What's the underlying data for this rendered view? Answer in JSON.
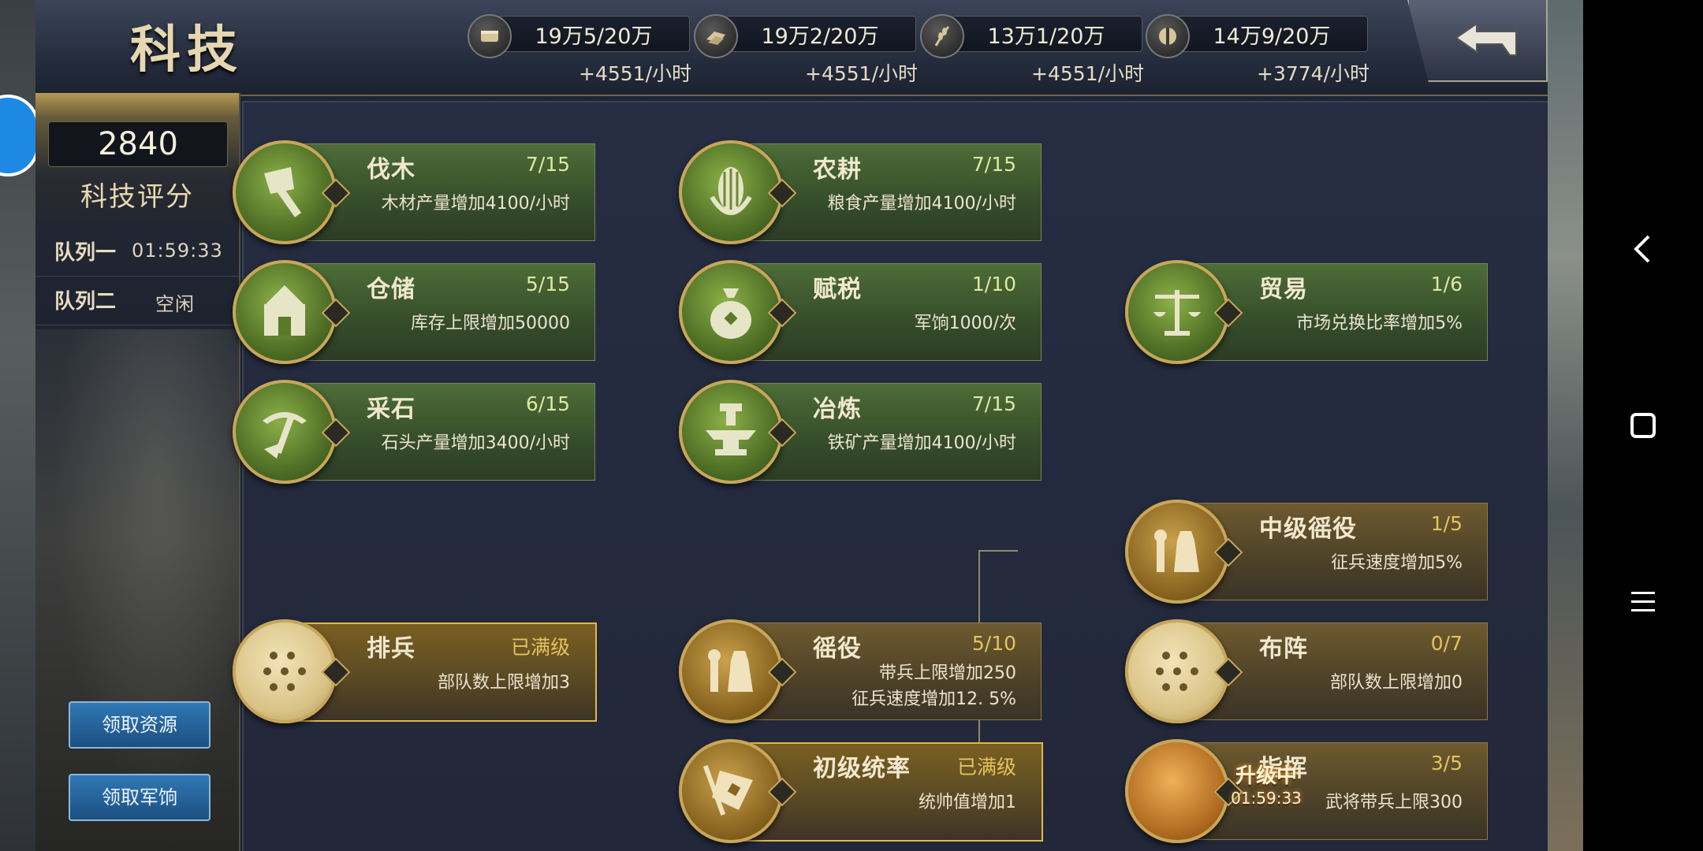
{
  "header": {
    "title": "科技"
  },
  "resources": [
    {
      "icon": "wood-icon",
      "amount": "19万5/20万",
      "rate": "+4551/小时"
    },
    {
      "icon": "stone-icon",
      "amount": "19万2/20万",
      "rate": "+4551/小时"
    },
    {
      "icon": "grain-icon",
      "amount": "13万1/20万",
      "rate": "+4551/小时"
    },
    {
      "icon": "iron-icon",
      "amount": "14万9/20万",
      "rate": "+3774/小时"
    }
  ],
  "sidebar": {
    "score": "2840",
    "score_label": "科技评分",
    "queue1_label": "队列一",
    "queue1_value": "01:59:33",
    "queue2_label": "队列二",
    "queue2_value": "空闲",
    "claim_resources": "领取资源",
    "claim_pay": "领取军饷"
  },
  "techs": {
    "famu": {
      "name": "伐木",
      "level": "7/15",
      "desc": "木材产量增加4100/小时"
    },
    "nonggeng": {
      "name": "农耕",
      "level": "7/15",
      "desc": "粮食产量增加4100/小时"
    },
    "cangchu": {
      "name": "仓储",
      "level": "5/15",
      "desc": "库存上限增加50000"
    },
    "fushui": {
      "name": "赋税",
      "level": "1/10",
      "desc": "军饷1000/次"
    },
    "maoyi": {
      "name": "贸易",
      "level": "1/6",
      "desc": "市场兑换比率增加5%"
    },
    "caishi": {
      "name": "采石",
      "level": "6/15",
      "desc": "石头产量增加3400/小时"
    },
    "yelian": {
      "name": "冶炼",
      "level": "7/15",
      "desc": "铁矿产量增加4100/小时"
    },
    "zhongji": {
      "name": "中级徭役",
      "level": "1/5",
      "desc": "征兵速度增加5%"
    },
    "paibing": {
      "name": "排兵",
      "level": "已满级",
      "desc": "部队数上限增加3"
    },
    "yaoyi": {
      "name": "徭役",
      "level": "5/10",
      "desc1": "带兵上限增加250",
      "desc2": "征兵速度增加12. 5%"
    },
    "buzhen": {
      "name": "布阵",
      "level": "0/7",
      "desc": "部队数上限增加0"
    },
    "chuji": {
      "name": "初级统率",
      "level": "已满级",
      "desc": "统帅值增加1"
    },
    "zhihui": {
      "name": "指挥",
      "level": "3/5",
      "desc": "武将带兵上限300",
      "status": "升级中",
      "timer": "01:59:33"
    }
  },
  "colors": {
    "green_node": "#4e6d38",
    "gold_node": "#6e5a2e",
    "max_border": "#e3b84a",
    "button_blue": "#2f78b5"
  }
}
